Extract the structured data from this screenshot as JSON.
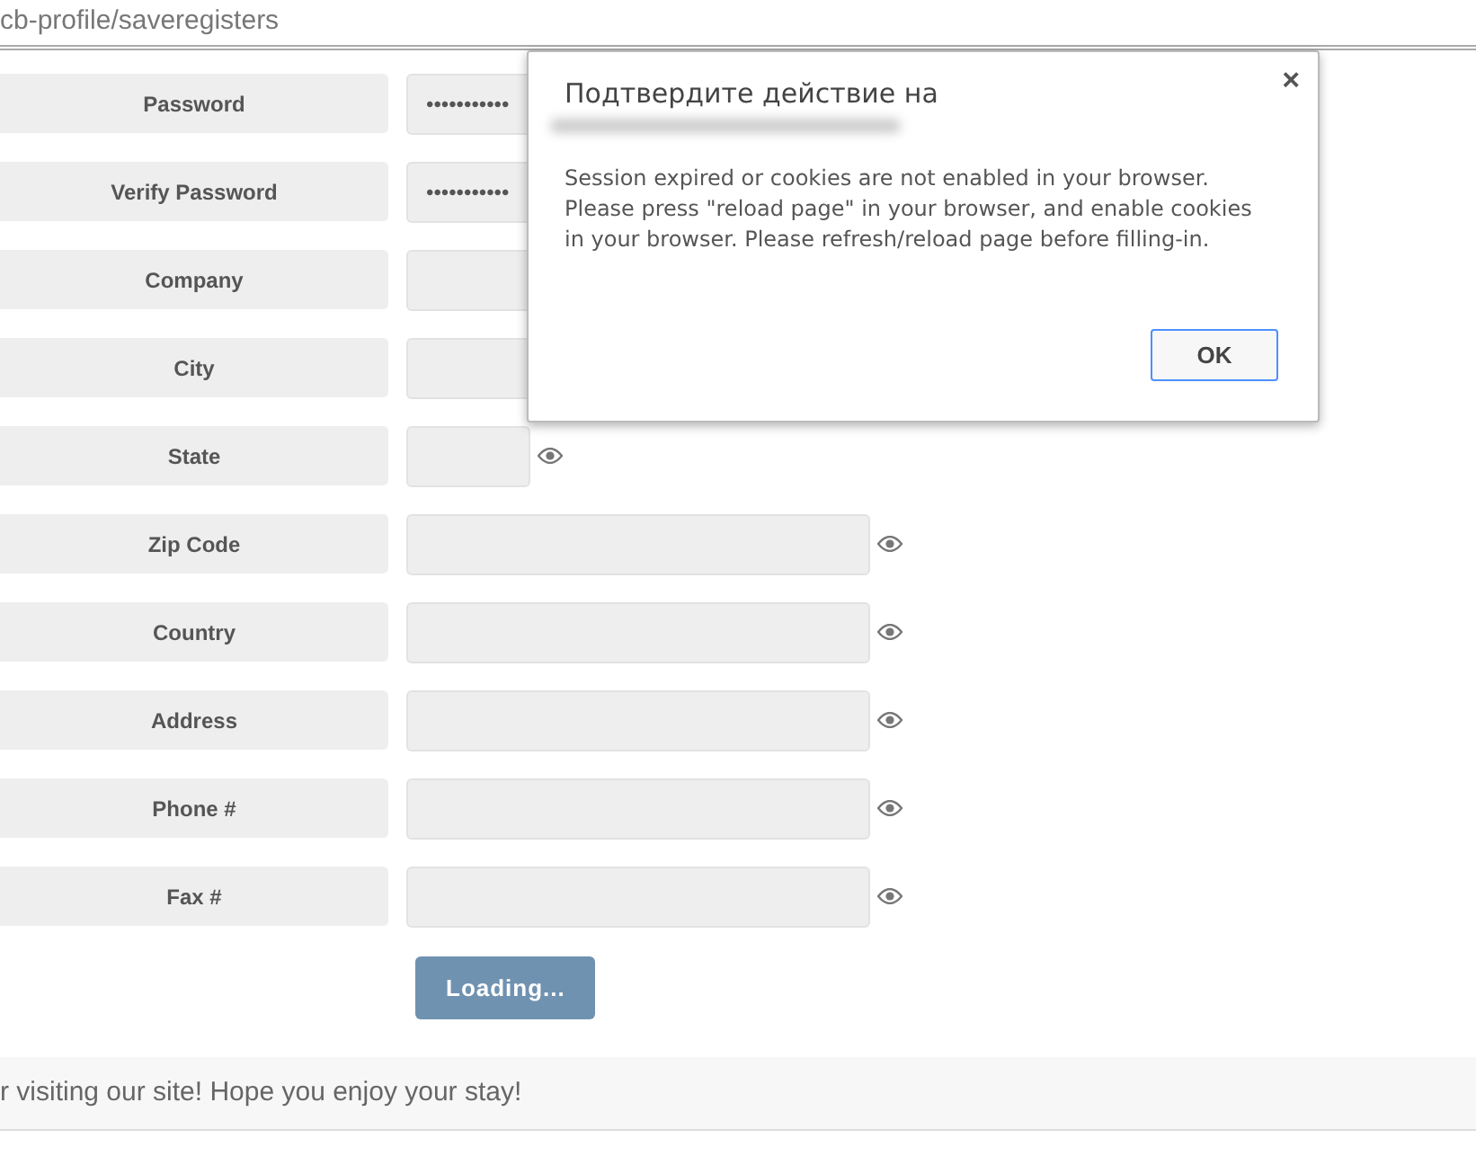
{
  "address_bar": {
    "url": "cb-profile/saveregisters"
  },
  "form": {
    "fields": [
      {
        "label": "Password",
        "value": "•••••••••••",
        "kind": "covered"
      },
      {
        "label": "Verify Password",
        "value": "•••••••••••",
        "kind": "covered"
      },
      {
        "label": "Company",
        "kind": "covered"
      },
      {
        "label": "City",
        "kind": "covered"
      },
      {
        "label": "State",
        "kind": "short"
      },
      {
        "label": "Zip Code",
        "kind": "long"
      },
      {
        "label": "Country",
        "kind": "long"
      },
      {
        "label": "Address",
        "kind": "long"
      },
      {
        "label": "Phone #",
        "kind": "long"
      },
      {
        "label": "Fax #",
        "kind": "long"
      }
    ],
    "submit_button": {
      "label": "Loading...",
      "disabled": true
    }
  },
  "footer": {
    "text": "r visiting our site! Hope you enjoy your stay!"
  },
  "dialog": {
    "title": "Подтвердите действие на",
    "close": "×",
    "message": "Session expired or cookies are not enabled in your browser. Please press \"reload page\" in your browser, and enable cookies in your browser. Please refresh/reload page before filling-in.",
    "buttons": [
      "OK"
    ]
  }
}
